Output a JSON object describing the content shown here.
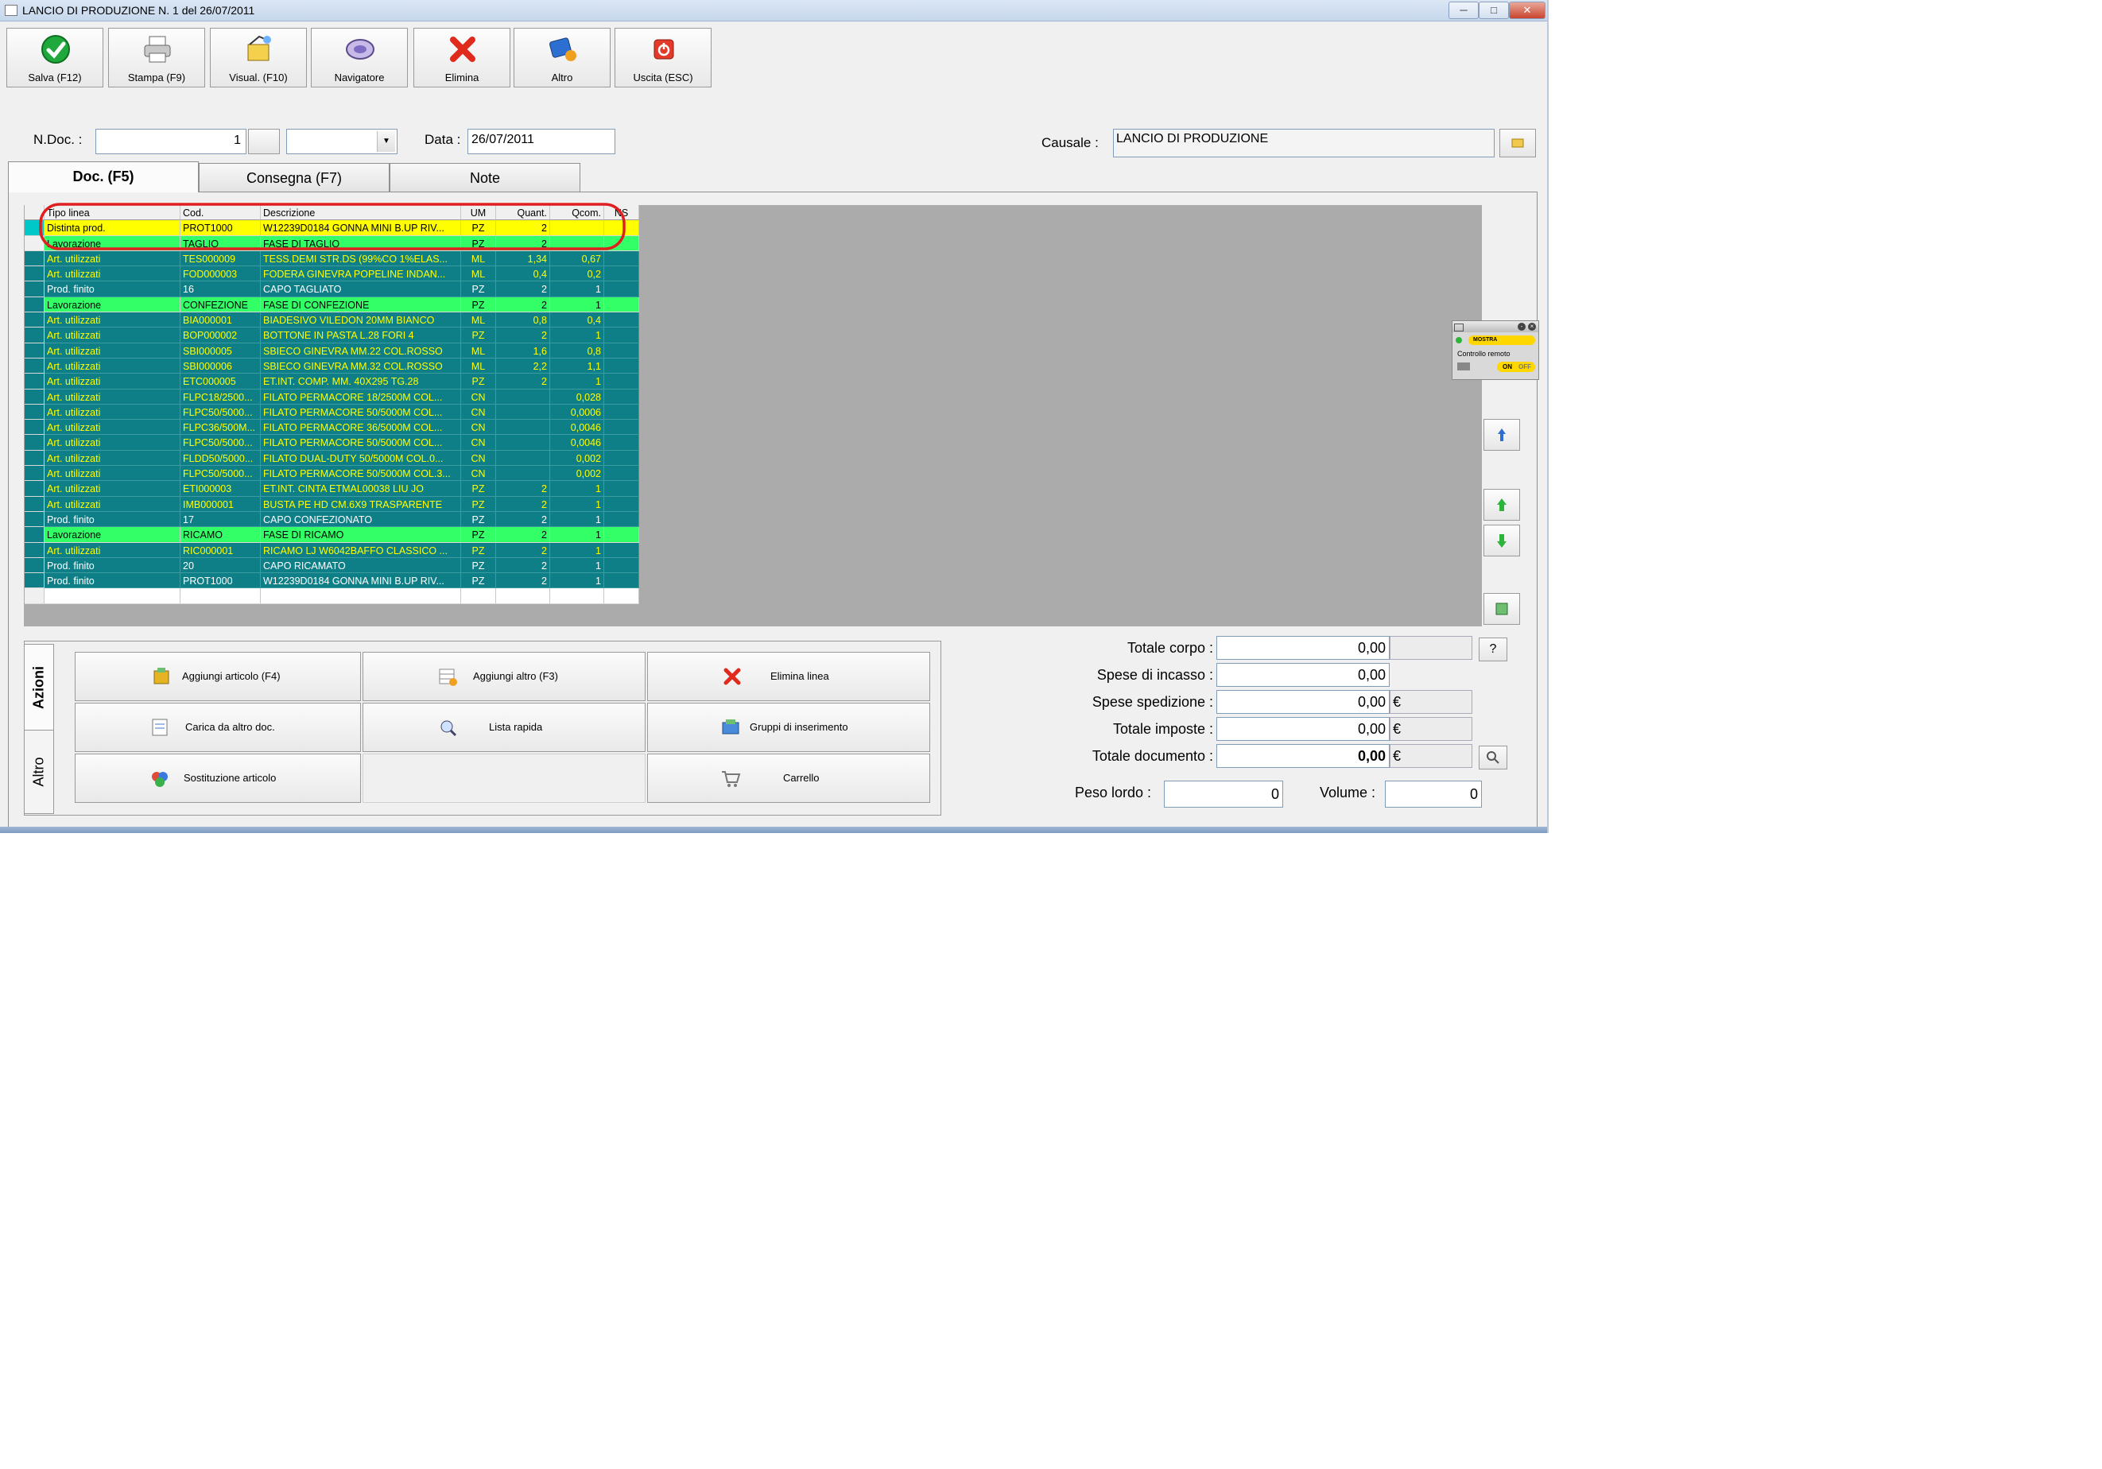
{
  "window": {
    "title": "LANCIO DI PRODUZIONE N. 1  del 26/07/2011",
    "controls": {
      "minimize": "─",
      "maximize": "□",
      "close": "✕"
    }
  },
  "toolbar": [
    {
      "label": "Salva (F12)",
      "icon": "check-icon"
    },
    {
      "label": "Stampa (F9)",
      "icon": "printer-icon"
    },
    {
      "label": "Visual. (F10)",
      "icon": "preview-icon"
    },
    {
      "label": "Navigatore",
      "icon": "navigator-icon"
    },
    {
      "label": "Elimina",
      "icon": "delete-icon"
    },
    {
      "label": "Altro",
      "icon": "more-icon"
    },
    {
      "label": "Uscita (ESC)",
      "icon": "exit-icon"
    }
  ],
  "header": {
    "ndoc_label": "N.Doc. :",
    "ndoc_value": "1",
    "data_label": "Data :",
    "data_value": "26/07/2011",
    "causale_label": "Causale :",
    "causale_value": "LANCIO DI PRODUZIONE"
  },
  "tabs": [
    "Doc. (F5)",
    "Consegna (F7)",
    "Note"
  ],
  "grid": {
    "columns": [
      "Tipo linea",
      "Cod.",
      "Descrizione",
      "UM",
      "Quant.",
      "Qcom.",
      "NS"
    ],
    "rows": [
      {
        "style": "yellow",
        "cells": [
          "Distinta prod.",
          "PROT1000",
          "W12239D0184 GONNA MINI B.UP RIV...",
          "PZ",
          "2",
          "",
          ""
        ]
      },
      {
        "style": "green",
        "cells": [
          "Lavorazione",
          "TAGLIO",
          "FASE DI TAGLIO",
          "PZ",
          "2",
          "",
          ""
        ]
      },
      {
        "style": "teal",
        "cells": [
          "Art. utilizzati",
          "TES000009",
          "TESS.DEMI STR.DS (99%CO 1%ELAS...",
          "ML",
          "1,34",
          "0,67",
          ""
        ]
      },
      {
        "style": "teal",
        "cells": [
          "Art. utilizzati",
          "FOD000003",
          "FODERA GINEVRA POPELINE INDAN...",
          "ML",
          "0,4",
          "0,2",
          ""
        ]
      },
      {
        "style": "tealw",
        "cells": [
          "Prod. finito",
          "16",
          "CAPO TAGLIATO",
          "PZ",
          "2",
          "1",
          ""
        ]
      },
      {
        "style": "green",
        "cells": [
          "Lavorazione",
          "CONFEZIONE",
          "FASE DI CONFEZIONE",
          "PZ",
          "2",
          "1",
          ""
        ]
      },
      {
        "style": "teal",
        "cells": [
          "Art. utilizzati",
          "BIA000001",
          "BIADESIVO VILEDON 20MM BIANCO",
          "ML",
          "0,8",
          "0,4",
          ""
        ]
      },
      {
        "style": "teal",
        "cells": [
          "Art. utilizzati",
          "BOP000002",
          "BOTTONE IN PASTA L.28 FORI 4",
          "PZ",
          "2",
          "1",
          ""
        ]
      },
      {
        "style": "teal",
        "cells": [
          "Art. utilizzati",
          "SBI000005",
          "SBIECO GINEVRA MM.22 COL.ROSSO",
          "ML",
          "1,6",
          "0,8",
          ""
        ]
      },
      {
        "style": "teal",
        "cells": [
          "Art. utilizzati",
          "SBI000006",
          "SBIECO GINEVRA MM.32 COL.ROSSO",
          "ML",
          "2,2",
          "1,1",
          ""
        ]
      },
      {
        "style": "teal",
        "cells": [
          "Art. utilizzati",
          "ETC000005",
          "ET.INT. COMP. MM. 40X295 TG.28",
          "PZ",
          "2",
          "1",
          ""
        ]
      },
      {
        "style": "teal",
        "cells": [
          "Art. utilizzati",
          "FLPC18/2500...",
          "FILATO PERMACORE 18/2500M COL...",
          "CN",
          "",
          "0,028",
          ""
        ]
      },
      {
        "style": "teal",
        "cells": [
          "Art. utilizzati",
          "FLPC50/5000...",
          "FILATO PERMACORE 50/5000M COL...",
          "CN",
          "",
          "0,0006",
          ""
        ]
      },
      {
        "style": "teal",
        "cells": [
          "Art. utilizzati",
          "FLPC36/500M...",
          "FILATO PERMACORE 36/5000M COL...",
          "CN",
          "",
          "0,0046",
          ""
        ]
      },
      {
        "style": "teal",
        "cells": [
          "Art. utilizzati",
          "FLPC50/5000...",
          "FILATO PERMACORE 50/5000M COL...",
          "CN",
          "",
          "0,0046",
          ""
        ]
      },
      {
        "style": "teal",
        "cells": [
          "Art. utilizzati",
          "FLDD50/5000...",
          "FILATO DUAL-DUTY 50/5000M COL.0...",
          "CN",
          "",
          "0,002",
          ""
        ]
      },
      {
        "style": "teal",
        "cells": [
          "Art. utilizzati",
          "FLPC50/5000...",
          "FILATO PERMACORE 50/5000M COL.3...",
          "CN",
          "",
          "0,002",
          ""
        ]
      },
      {
        "style": "teal",
        "cells": [
          "Art. utilizzati",
          "ETI000003",
          "ET.INT. CINTA ETMAL00038 LIU JO",
          "PZ",
          "2",
          "1",
          ""
        ]
      },
      {
        "style": "teal",
        "cells": [
          "Art. utilizzati",
          "IMB000001",
          "BUSTA PE HD CM.6X9 TRASPARENTE",
          "PZ",
          "2",
          "1",
          ""
        ]
      },
      {
        "style": "tealw",
        "cells": [
          "Prod. finito",
          "17",
          "CAPO CONFEZIONATO",
          "PZ",
          "2",
          "1",
          ""
        ]
      },
      {
        "style": "green",
        "cells": [
          "Lavorazione",
          "RICAMO",
          "FASE DI RICAMO",
          "PZ",
          "2",
          "1",
          ""
        ]
      },
      {
        "style": "teal",
        "cells": [
          "Art. utilizzati",
          "RIC000001",
          "RICAMO LJ W6042BAFFO CLASSICO ...",
          "PZ",
          "2",
          "1",
          ""
        ]
      },
      {
        "style": "tealw",
        "cells": [
          "Prod. finito",
          "20",
          "CAPO RICAMATO",
          "PZ",
          "2",
          "1",
          ""
        ]
      },
      {
        "style": "tealw",
        "cells": [
          "Prod. finito",
          "PROT1000",
          "W12239D0184 GONNA MINI B.UP RIV...",
          "PZ",
          "2",
          "1",
          ""
        ]
      },
      {
        "style": "blank",
        "cells": [
          "",
          "",
          "",
          "",
          "",
          "",
          ""
        ]
      }
    ]
  },
  "remote_widget": {
    "mostra": "MOSTRA",
    "label": "Controllo remoto",
    "on": "ON",
    "off": "OFF"
  },
  "actions": {
    "vtabs": [
      "Azioni",
      "Altro"
    ],
    "buttons": [
      {
        "label": "Aggiungi articolo (F4)",
        "icon": "add-article-icon"
      },
      {
        "label": "Aggiungi altro (F3)",
        "icon": "add-other-icon"
      },
      {
        "label": "Elimina linea",
        "icon": "delete-line-icon"
      },
      {
        "label": "Carica da altro doc.",
        "icon": "load-doc-icon"
      },
      {
        "label": "Lista rapida",
        "icon": "quick-list-icon"
      },
      {
        "label": "Gruppi di inserimento",
        "icon": "groups-icon"
      },
      {
        "label": "Sostituzione articolo",
        "icon": "replace-article-icon"
      },
      {
        "label": "Carrello",
        "icon": "cart-icon"
      }
    ]
  },
  "totals": {
    "totale_corpo_label": "Totale corpo :",
    "totale_corpo": "0,00",
    "spese_incasso_label": "Spese di incasso :",
    "spese_incasso": "0,00",
    "spese_spedizione_label": "Spese spedizione :",
    "spese_spedizione": "0,00",
    "totale_imposte_label": "Totale imposte :",
    "totale_imposte": "0,00",
    "totale_documento_label": "Totale documento :",
    "totale_documento": "0,00",
    "currency": "€",
    "help": "?",
    "peso_label": "Peso lordo :",
    "peso": "0",
    "volume_label": "Volume :",
    "volume": "0"
  },
  "colors": {
    "teal": "#0e7f86",
    "yellow": "#ffff00",
    "green": "#33ff66",
    "highlight_circle": "#e02020"
  }
}
